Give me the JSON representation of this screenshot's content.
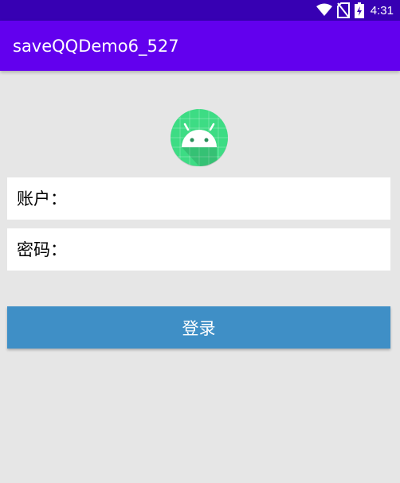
{
  "status_bar": {
    "time": "4:31",
    "icons": [
      "wifi-icon",
      "no-sim-icon",
      "battery-charging-icon"
    ]
  },
  "app_bar": {
    "title": "saveQQDemo6_527"
  },
  "logo": {
    "icon": "android-icon"
  },
  "form": {
    "account_label": "账户：",
    "account_value": "",
    "password_label": "密码：",
    "password_value": "",
    "login_label": "登录"
  },
  "colors": {
    "status_bar": "#3700b3",
    "app_bar": "#6200ee",
    "background": "#e6e6e6",
    "button": "#3f8fc6",
    "logo_green": "#3ddc84"
  }
}
